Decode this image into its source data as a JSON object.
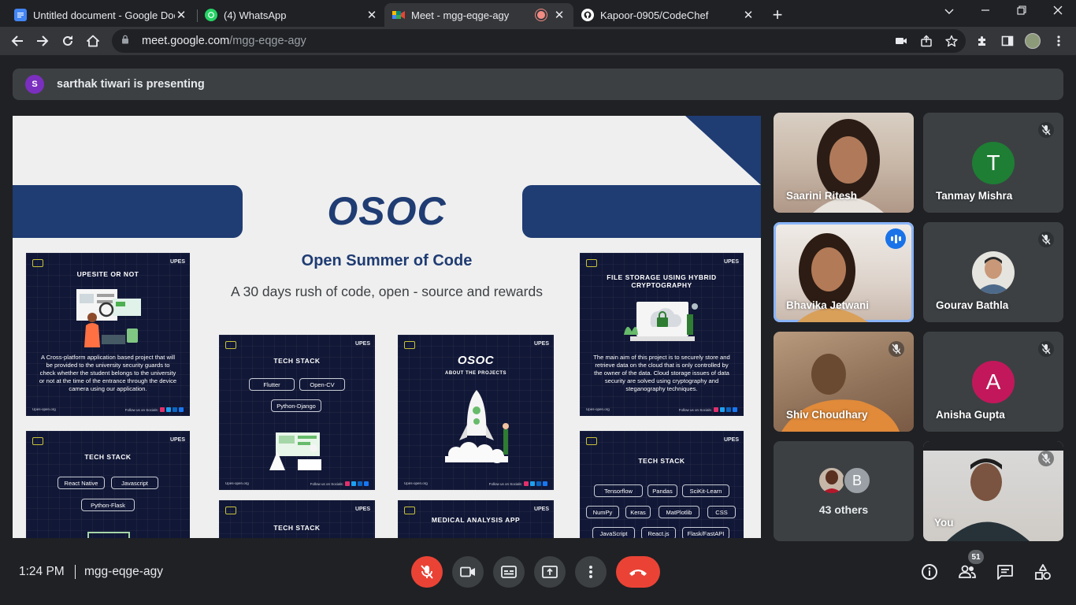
{
  "browser": {
    "tabs": [
      {
        "title": "Untitled document - Google Doc",
        "icon": "google-docs-icon",
        "color": "#4285f4"
      },
      {
        "title": "(4) WhatsApp",
        "icon": "whatsapp-icon",
        "color": "#25d366"
      },
      {
        "title": "Meet - mgg-eqge-agy",
        "icon": "google-meet-icon",
        "color": "#00897b"
      },
      {
        "title": "Kapoor-0905/CodeChef",
        "icon": "github-icon",
        "color": "#ffffff"
      }
    ],
    "url_host": "meet.google.com",
    "url_path": "/mgg-eqge-agy"
  },
  "meet": {
    "banner": {
      "initial": "S",
      "text": "sarthak tiwari is presenting"
    },
    "slide": {
      "title": "OSOC",
      "subtitle": "Open Summer of Code",
      "tagline": "A 30 days rush of code, open - source and rewards",
      "upes": "UPES",
      "footer_left": "Upes-open.org",
      "footer_right": "Follow us on Socials:",
      "cards": {
        "upesite": {
          "title": "UPESITE OR NOT",
          "body": "A Cross-platform application based project that will be provided to the university security guards to check whether the student belongs to the university or not at the time of the entrance through the device camera using our application."
        },
        "storage": {
          "title": "FILE STORAGE USING HYBRID CRYPTOGRAPHY",
          "body": "The main aim of this project is to securely store and retrieve data on the cloud that is only controlled by the owner of the data. Cloud storage issues of data security are solved using cryptography and steganography techniques."
        },
        "tech1": {
          "title": "TECH STACK",
          "pills": [
            "Flutter",
            "Open-CV",
            "Python-Django"
          ]
        },
        "about": {
          "title": "OSOC",
          "subtitle": "ABOUT THE PROJECTS"
        },
        "tech2": {
          "title": "TECH STACK",
          "pills": [
            "React Native",
            "Javascript",
            "Python-Flask"
          ]
        },
        "tech3": {
          "title": "TECH STACK",
          "pills": [
            "Tensorflow",
            "Pandas",
            "SciKit-Learn",
            "NumPy",
            "Keras",
            "MatPlotlib",
            "CSS",
            "JavaScript",
            "React.js",
            "Flask/FastAPI"
          ]
        },
        "tech4": {
          "title": "TECH STACK"
        },
        "medical": {
          "title": "MEDICAL ANALYSIS APP"
        }
      }
    },
    "participants": [
      {
        "name": "Saarini Ritesh",
        "type": "video"
      },
      {
        "name": "Tanmay Mishra",
        "initial": "T",
        "color": "#1e7e34",
        "muted": true
      },
      {
        "name": "Bhavika Jetwani",
        "type": "video",
        "speaking": true
      },
      {
        "name": "Gourav Bathla",
        "type": "photo",
        "muted": true
      },
      {
        "name": "Shiv Choudhary",
        "type": "video",
        "muted": true
      },
      {
        "name": "Anisha Gupta",
        "initial": "A",
        "color": "#c2185b",
        "muted": true
      },
      {
        "name": "You",
        "type": "video",
        "muted": true
      }
    ],
    "others": {
      "label": "43 others",
      "initial": "B"
    },
    "bottom": {
      "time": "1:24 PM",
      "meeting_code": "mgg-eqge-agy",
      "people_count": "51"
    },
    "colors": {
      "accent": "#8ab4f8",
      "danger": "#ea4335",
      "surface": "#3c4043",
      "background": "#202124"
    }
  }
}
